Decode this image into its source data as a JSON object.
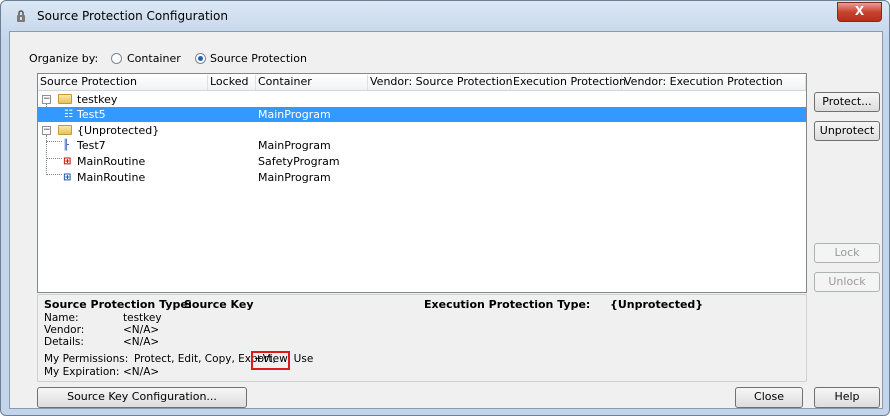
{
  "window": {
    "title": "Source Protection Configuration",
    "close_label": "X"
  },
  "organize": {
    "label": "Organize by:",
    "options": [
      {
        "label": "Container",
        "selected": false
      },
      {
        "label": "Source Protection",
        "selected": true
      }
    ]
  },
  "grid": {
    "columns": [
      "Source Protection",
      "Locked",
      "Container",
      "Vendor: Source Protection",
      "Execution Protection",
      "Vendor: Execution Protection"
    ],
    "rows": [
      {
        "name": "testkey",
        "container": "",
        "level": 0,
        "kind": "folder",
        "expanded": true,
        "selected": false
      },
      {
        "name": "Test5",
        "container": "MainProgram",
        "level": 1,
        "kind": "program",
        "selected": true
      },
      {
        "name": "{Unprotected}",
        "container": "",
        "level": 0,
        "kind": "folder",
        "expanded": true,
        "selected": false
      },
      {
        "name": "Test7",
        "container": "MainProgram",
        "level": 1,
        "kind": "ladder",
        "selected": false
      },
      {
        "name": "MainRoutine",
        "container": "SafetyProgram",
        "level": 1,
        "kind": "routine-safety",
        "selected": false
      },
      {
        "name": "MainRoutine",
        "container": "MainProgram",
        "level": 1,
        "kind": "routine",
        "selected": false
      }
    ]
  },
  "side_buttons": {
    "protect": "Protect...",
    "unprotect": "Unprotect",
    "lock": "Lock",
    "unlock": "Unlock"
  },
  "details": {
    "type_label": "Source Protection Type:",
    "type_value": "Source Key",
    "exec_label": "Execution Protection Type:",
    "exec_value": "{Unprotected}",
    "name_label": "Name:",
    "name_value": "testkey",
    "vendor_label": "Vendor:",
    "vendor_value": "<N/A>",
    "details_label": "Details:",
    "details_value": "<N/A>",
    "permissions_label": "My Permissions:",
    "permissions_prefix": "Protect, Edit, Copy, Export,",
    "permissions_highlight": "+View",
    "permissions_suffix": ", Use",
    "expiration_label": "My Expiration:",
    "expiration_value": "<N/A>"
  },
  "bottom_buttons": {
    "source_key_config": "Source Key Configuration...",
    "close": "Close",
    "help": "Help"
  },
  "colors": {
    "selection": "#3399ff",
    "highlight_box": "#e0191b"
  }
}
